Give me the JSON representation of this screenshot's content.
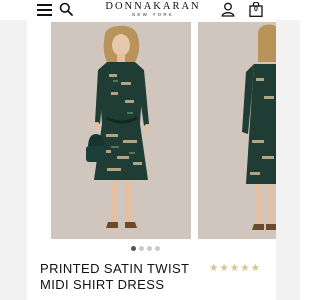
{
  "header": {
    "brand_name": "DONNAKARAN",
    "brand_sub": "NEW YORK",
    "bag_count": "0",
    "icons": [
      "menu-icon",
      "search-icon",
      "account-icon",
      "bag-icon"
    ]
  },
  "gallery": {
    "slides": [
      "main-product-photo",
      "second-product-photo"
    ],
    "dot_count": 4,
    "active_index": 0
  },
  "product": {
    "title_line1": "PRINTED SATIN TWIST",
    "title_line2": "MIDI SHIRT DRESS",
    "rating": {
      "value": 5,
      "max": 5,
      "star_color": "#d6c58d"
    }
  },
  "colors": {
    "header_bg": "#ffffff",
    "photo_bg": "#d1c6bd",
    "dress_green": "#1f3d34",
    "side_bg": "#f2f2f2"
  }
}
